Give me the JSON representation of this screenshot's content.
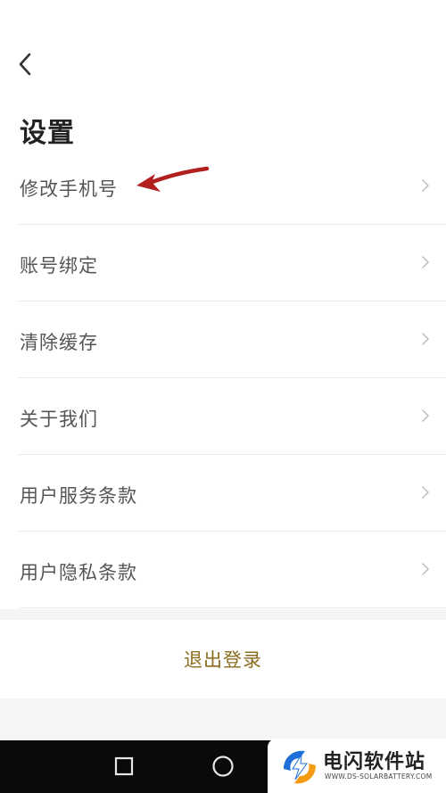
{
  "header": {
    "back_icon": "chevron-left-icon",
    "title": "设置"
  },
  "settings": {
    "items": [
      {
        "label": "修改手机号"
      },
      {
        "label": "账号绑定"
      },
      {
        "label": "清除缓存"
      },
      {
        "label": "关于我们"
      },
      {
        "label": "用户服务条款"
      },
      {
        "label": "用户隐私条款"
      }
    ]
  },
  "logout": {
    "label": "退出登录"
  },
  "colors": {
    "accent": "#8a6d1e",
    "annotation_arrow": "#b21f1f",
    "divider": "#ebebeb",
    "nav_bar": "#0a0a0a"
  },
  "nav": {
    "icons": [
      "square-icon",
      "circle-icon"
    ]
  },
  "watermark": {
    "title": "电闪软件站",
    "subtitle": "WWW.DS-SOLARBATTERY.COM"
  }
}
